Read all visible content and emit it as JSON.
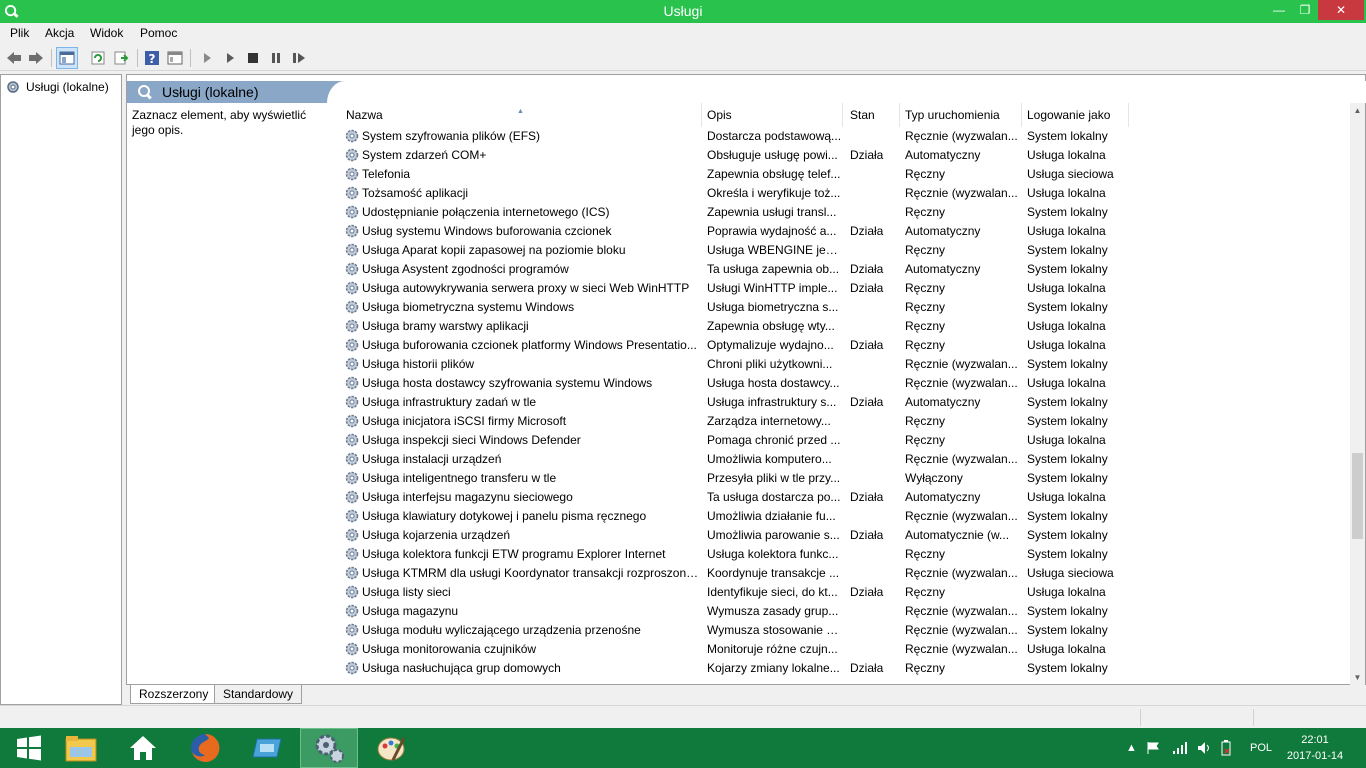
{
  "window": {
    "title": "Usługi",
    "controls": {
      "minimize": "—",
      "maximize": "❐",
      "close": "✕"
    }
  },
  "menu": [
    "Plik",
    "Akcja",
    "Widok",
    "Pomoc"
  ],
  "toolbar_icons": [
    "back-arrow-icon",
    "forward-arrow-icon",
    "console-tree-icon",
    "refresh-icon",
    "export-list-icon",
    "help-icon",
    "properties-icon",
    "start-service-icon",
    "start-service-alt-icon",
    "stop-service-icon",
    "pause-service-icon",
    "restart-service-icon"
  ],
  "tree": {
    "item": "Usługi (lokalne)"
  },
  "pane": {
    "title": "Usługi (lokalne)",
    "description": "Zaznacz element, aby wyświetlić jego opis."
  },
  "columns": {
    "name": "Nazwa",
    "description": "Opis",
    "status": "Stan",
    "startup": "Typ uruchomienia",
    "logon": "Logowanie jako"
  },
  "services": [
    {
      "name": "System szyfrowania plików (EFS)",
      "desc": "Dostarcza podstawową...",
      "status": "",
      "startup": "Ręcznie (wyzwalan...",
      "logon": "System lokalny"
    },
    {
      "name": "System zdarzeń COM+",
      "desc": "Obsługuje usługę powi...",
      "status": "Działa",
      "startup": "Automatyczny",
      "logon": "Usługa lokalna"
    },
    {
      "name": "Telefonia",
      "desc": "Zapewnia obsługę telef...",
      "status": "",
      "startup": "Ręczny",
      "logon": "Usługa sieciowa"
    },
    {
      "name": "Tożsamość aplikacji",
      "desc": "Określa i weryfikuje toż...",
      "status": "",
      "startup": "Ręcznie (wyzwalan...",
      "logon": "Usługa lokalna"
    },
    {
      "name": "Udostępnianie połączenia internetowego (ICS)",
      "desc": "Zapewnia usługi transl...",
      "status": "",
      "startup": "Ręczny",
      "logon": "System lokalny"
    },
    {
      "name": "Usług systemu Windows buforowania czcionek",
      "desc": "Poprawia wydajność a...",
      "status": "Działa",
      "startup": "Automatyczny",
      "logon": "Usługa lokalna"
    },
    {
      "name": "Usługa Aparat kopii zapasowej na poziomie bloku",
      "desc": "Usługa WBENGINE jest ...",
      "status": "",
      "startup": "Ręczny",
      "logon": "System lokalny"
    },
    {
      "name": "Usługa Asystent zgodności programów",
      "desc": "Ta usługa zapewnia ob...",
      "status": "Działa",
      "startup": "Automatyczny",
      "logon": "System lokalny"
    },
    {
      "name": "Usługa autowykrywania serwera proxy w sieci Web WinHTTP",
      "desc": "Usługi WinHTTP imple...",
      "status": "Działa",
      "startup": "Ręczny",
      "logon": "Usługa lokalna"
    },
    {
      "name": "Usługa biometryczna systemu Windows",
      "desc": "Usługa biometryczna s...",
      "status": "",
      "startup": "Ręczny",
      "logon": "System lokalny"
    },
    {
      "name": "Usługa bramy warstwy aplikacji",
      "desc": "Zapewnia obsługę wty...",
      "status": "",
      "startup": "Ręczny",
      "logon": "Usługa lokalna"
    },
    {
      "name": "Usługa buforowania czcionek platformy Windows Presentatio...",
      "desc": "Optymalizuje wydajno...",
      "status": "Działa",
      "startup": "Ręczny",
      "logon": "Usługa lokalna"
    },
    {
      "name": "Usługa historii plików",
      "desc": "Chroni pliki użytkowni...",
      "status": "",
      "startup": "Ręcznie (wyzwalan...",
      "logon": "System lokalny"
    },
    {
      "name": "Usługa hosta dostawcy szyfrowania systemu Windows",
      "desc": "Usługa hosta dostawcy...",
      "status": "",
      "startup": "Ręcznie (wyzwalan...",
      "logon": "Usługa lokalna"
    },
    {
      "name": "Usługa infrastruktury zadań w tle",
      "desc": "Usługa infrastruktury s...",
      "status": "Działa",
      "startup": "Automatyczny",
      "logon": "System lokalny"
    },
    {
      "name": "Usługa inicjatora iSCSI firmy Microsoft",
      "desc": "Zarządza internetowy...",
      "status": "",
      "startup": "Ręczny",
      "logon": "System lokalny"
    },
    {
      "name": "Usługa inspekcji sieci Windows Defender",
      "desc": "Pomaga chronić przed ...",
      "status": "",
      "startup": "Ręczny",
      "logon": "Usługa lokalna"
    },
    {
      "name": "Usługa instalacji urządzeń",
      "desc": "Umożliwia komputero...",
      "status": "",
      "startup": "Ręcznie (wyzwalan...",
      "logon": "System lokalny"
    },
    {
      "name": "Usługa inteligentnego transferu w tle",
      "desc": "Przesyła pliki w tle przy...",
      "status": "",
      "startup": "Wyłączony",
      "logon": "System lokalny"
    },
    {
      "name": "Usługa interfejsu magazynu sieciowego",
      "desc": "Ta usługa dostarcza po...",
      "status": "Działa",
      "startup": "Automatyczny",
      "logon": "Usługa lokalna"
    },
    {
      "name": "Usługa klawiatury dotykowej i panelu pisma ręcznego",
      "desc": "Umożliwia działanie fu...",
      "status": "",
      "startup": "Ręcznie (wyzwalan...",
      "logon": "System lokalny"
    },
    {
      "name": "Usługa kojarzenia urządzeń",
      "desc": "Umożliwia parowanie s...",
      "status": "Działa",
      "startup": "Automatycznie (w...",
      "logon": "System lokalny"
    },
    {
      "name": "Usługa kolektora funkcji ETW programu Explorer Internet",
      "desc": "Usługa kolektora funkc...",
      "status": "",
      "startup": "Ręczny",
      "logon": "System lokalny"
    },
    {
      "name": "Usługa KTMRM dla usługi Koordynator transakcji rozproszonych",
      "desc": "Koordynuje transakcje ...",
      "status": "",
      "startup": "Ręcznie (wyzwalan...",
      "logon": "Usługa sieciowa"
    },
    {
      "name": "Usługa listy sieci",
      "desc": "Identyfikuje sieci, do kt...",
      "status": "Działa",
      "startup": "Ręczny",
      "logon": "Usługa lokalna"
    },
    {
      "name": "Usługa magazynu",
      "desc": "Wymusza zasady grup...",
      "status": "",
      "startup": "Ręcznie (wyzwalan...",
      "logon": "System lokalny"
    },
    {
      "name": "Usługa modułu wyliczającego urządzenia przenośne",
      "desc": "Wymusza stosowanie z...",
      "status": "",
      "startup": "Ręcznie (wyzwalan...",
      "logon": "System lokalny"
    },
    {
      "name": "Usługa monitorowania czujników",
      "desc": "Monitoruje różne czujn...",
      "status": "",
      "startup": "Ręcznie (wyzwalan...",
      "logon": "Usługa lokalna"
    },
    {
      "name": "Usługa nasłuchująca grup domowych",
      "desc": "Kojarzy zmiany lokalne...",
      "status": "Działa",
      "startup": "Ręczny",
      "logon": "System lokalny"
    }
  ],
  "tabs": [
    "Rozszerzony",
    "Standardowy"
  ],
  "taskbar": {
    "apps": [
      "windows-start-icon",
      "file-explorer-icon",
      "home-icon",
      "firefox-icon",
      "media-app-icon",
      "services-gear-icon",
      "paint-icon"
    ],
    "tray": {
      "language": "POL"
    },
    "clock": {
      "time": "22:01",
      "date": "2017-01-14"
    }
  },
  "colors": {
    "titlebar": "#28c24d",
    "taskbar": "#0f7a3b",
    "header": "#8aa7c7",
    "close": "#c7383f"
  }
}
